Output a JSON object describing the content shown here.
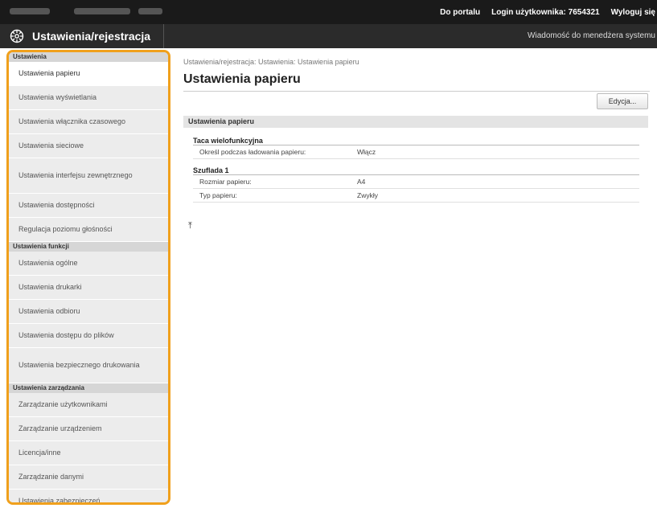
{
  "header": {
    "portal_link": "Do portalu",
    "login_label": "Login użytkownika:",
    "login_user": "7654321",
    "logout_link": "Wyloguj się",
    "app_title": "Ustawienia/rejestracja",
    "message_link": "Wiadomość do menedżera systemu"
  },
  "sidebar": {
    "section1": "Ustawienia",
    "items1": [
      "Ustawienia papieru",
      "Ustawienia wyświetlania",
      "Ustawienia włącznika czasowego",
      "Ustawienia sieciowe",
      "Ustawienia interfejsu zewnętrznego",
      "Ustawienia dostępności",
      "Regulacja poziomu głośności"
    ],
    "section2": "Ustawienia funkcji",
    "items2": [
      "Ustawienia ogólne",
      "Ustawienia drukarki",
      "Ustawienia odbioru",
      "Ustawienia dostępu do plików",
      "Ustawienia bezpiecznego drukowania"
    ],
    "section3": "Ustawienia zarządzania",
    "items3": [
      "Zarządzanie użytkownikami",
      "Zarządzanie urządzeniem",
      "Licencja/inne",
      "Zarządzanie danymi",
      "Ustawienia zabezpieczeń"
    ]
  },
  "main": {
    "breadcrumb": "Ustawienia/rejestracja: Ustawienia: Ustawienia papieru",
    "title": "Ustawienia papieru",
    "edit_button": "Edycja...",
    "section_title": "Ustawienia papieru",
    "group1_title": "Taca wielofunkcyjna",
    "group1_rows": [
      {
        "key": "Określ podczas ładowania papieru:",
        "value": "Włącz"
      }
    ],
    "group2_title": "Szuflada 1",
    "group2_rows": [
      {
        "key": "Rozmiar papieru:",
        "value": "A4"
      },
      {
        "key": "Typ papieru:",
        "value": "Zwykły"
      }
    ],
    "top_icon": "⤒"
  },
  "colors": {
    "sidebar_border": "#f0a01c",
    "topbar_bg": "#1a1a1a"
  }
}
